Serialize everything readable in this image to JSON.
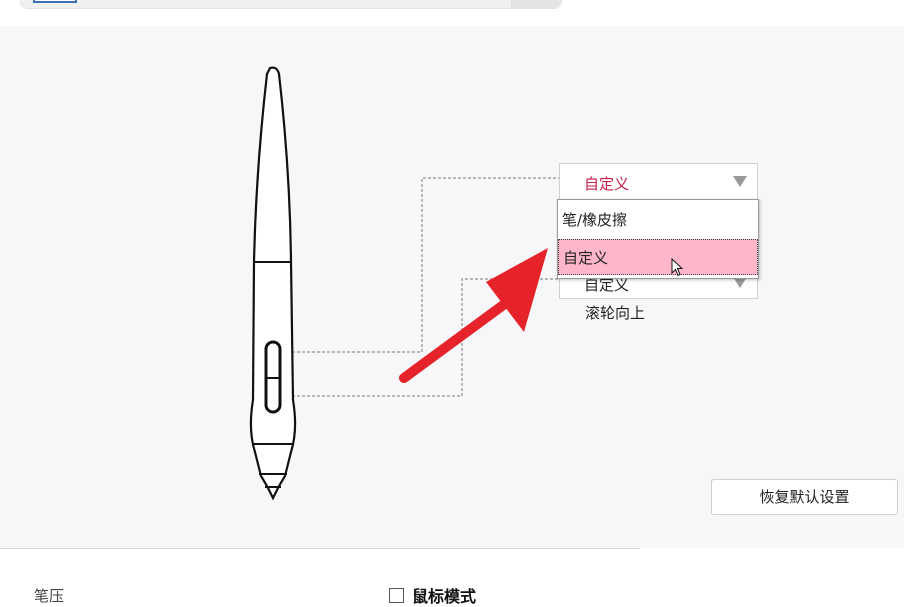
{
  "pen_settings": {
    "upper_button_dropdown": {
      "selected": "自定义"
    },
    "lower_button_dropdown": {
      "selected": "自定义",
      "sub_label": "滚轮向上"
    },
    "dropdown_menu": {
      "items": [
        "笔/橡皮擦",
        "自定义"
      ],
      "highlighted": "自定义"
    },
    "reset_button_label": "恢复默认设置"
  },
  "bottom": {
    "pressure_label": "笔压",
    "mouse_mode_label": "鼠标模式",
    "mouse_mode_checked": false
  },
  "colors": {
    "accent_text": "#c81e4a",
    "highlight": "#ffb6c8",
    "annotation_arrow": "#e6232a"
  },
  "icons": [
    "dropdown-arrow-icon",
    "mouse-cursor-icon",
    "annotation-arrow-icon",
    "checkbox-icon"
  ]
}
